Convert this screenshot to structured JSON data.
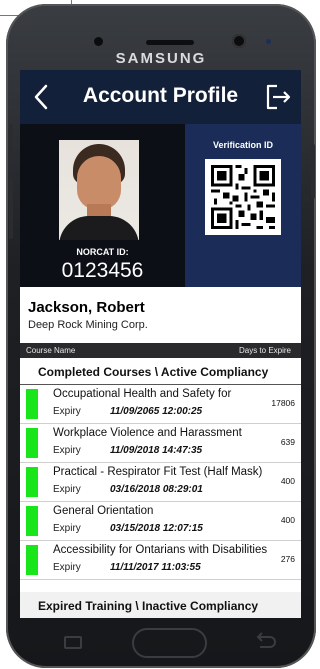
{
  "device": {
    "brand": "SAMSUNG"
  },
  "header": {
    "title": "Account Profile",
    "back_icon": "chevron-left-icon",
    "logout_icon": "logout-icon"
  },
  "id_card": {
    "norcat_label": "NORCAT ID:",
    "norcat_id": "0123456",
    "verification_label": "Verification ID"
  },
  "user": {
    "name": "Jackson, Robert",
    "company": "Deep Rock Mining Corp."
  },
  "columns": {
    "course_name": "Course Name",
    "days_to_expire": "Days to Expire"
  },
  "active_section": {
    "title": "Completed Courses \\ Active Compliancy",
    "courses": [
      {
        "name": "Occupational Health and Safety for",
        "expiry_label": "Expiry",
        "expiry": "11/09/2065 12:00:25",
        "days": "17806",
        "status_color": "#19e61a"
      },
      {
        "name": "Workplace Violence and Harassment",
        "expiry_label": "Expiry",
        "expiry": "11/09/2018 14:47:35",
        "days": "639",
        "status_color": "#19e61a"
      },
      {
        "name": "Practical - Respirator Fit Test (Half Mask)",
        "expiry_label": "Expiry",
        "expiry": "03/16/2018 08:29:01",
        "days": "400",
        "status_color": "#19e61a"
      },
      {
        "name": "General Orientation",
        "expiry_label": "Expiry",
        "expiry": "03/15/2018 12:07:15",
        "days": "400",
        "status_color": "#19e61a"
      },
      {
        "name": "Accessibility for Ontarians with Disabilities",
        "expiry_label": "Expiry",
        "expiry": "11/11/2017 11:03:55",
        "days": "276",
        "status_color": "#19e61a"
      }
    ]
  },
  "expired_section": {
    "title": "Expired Training \\ Inactive Compliancy"
  },
  "colors": {
    "header_bg": "#13203a",
    "verification_bg": "#1a2c57",
    "status_active": "#19e61a"
  }
}
